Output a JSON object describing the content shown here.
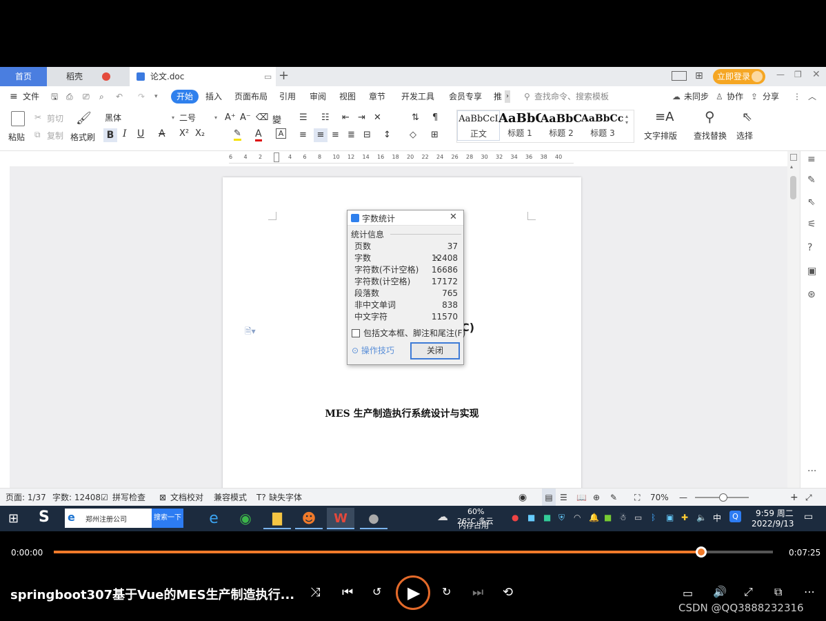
{
  "tabs": {
    "home": "首页",
    "daoke": "稻壳",
    "doc": "论文.doc",
    "login": "立即登录"
  },
  "menu": {
    "file": "文件",
    "items": [
      "开始",
      "插入",
      "页面布局",
      "引用",
      "审阅",
      "视图",
      "章节",
      "开发工具",
      "会员专享",
      "推"
    ],
    "search_placeholder": "查找命令、搜索模板",
    "sync": "未同步",
    "collab": "协作",
    "share": "分享"
  },
  "ribbon": {
    "paste": "粘贴",
    "cut": "剪切",
    "copy": "复制",
    "format_painter": "格式刷",
    "font": "黑体",
    "size": "二号",
    "styles": [
      {
        "preview": "AaBbCcI",
        "label": "正文"
      },
      {
        "preview": "AaBbC",
        "label": "标题 1"
      },
      {
        "preview": "AaBbC",
        "label": "标题 2"
      },
      {
        "preview": "AaBbCcI",
        "label": "标题 3"
      }
    ],
    "text_layout": "文字排版",
    "find_replace": "查找替换",
    "select": "选择"
  },
  "ruler_ticks": [
    "6",
    "4",
    "2",
    "2",
    "4",
    "6",
    "8",
    "10",
    "12",
    "14",
    "16",
    "18",
    "20",
    "22",
    "24",
    "26",
    "28",
    "30",
    "32",
    "34",
    "36",
    "38",
    "40"
  ],
  "document": {
    "title": "MES 生产制造执行系统设计与实现",
    "partial_glyph": "C)"
  },
  "dialog": {
    "title": "字数统计",
    "section": "统计信息",
    "rows": [
      {
        "label": "页数",
        "value": "37"
      },
      {
        "label": "字数",
        "value": "12408"
      },
      {
        "label": "字符数(不计空格)",
        "value": "16686"
      },
      {
        "label": "字符数(计空格)",
        "value": "17172"
      },
      {
        "label": "段落数",
        "value": "765"
      },
      {
        "label": "非中文单词",
        "value": "838"
      },
      {
        "label": "中文字符",
        "value": "11570"
      }
    ],
    "checkbox": "包括文本框、脚注和尾注(F)",
    "tips": "操作技巧",
    "close": "关闭"
  },
  "status": {
    "page": "页面: 1/37",
    "words": "字数: 12408",
    "spell": "拼写检查",
    "proof": "文档校对",
    "compat": "兼容模式",
    "missing_font": "缺失字体",
    "zoom": "70%"
  },
  "taskbar": {
    "search_text": "郑州注册公司",
    "search_btn": "搜索一下",
    "weather": "26°C 多云",
    "memory": "60%",
    "memory_label": "内存占用",
    "ime": "中",
    "time": "9:59 周二",
    "date": "2022/9/13"
  },
  "player": {
    "current": "0:00:00",
    "total": "0:07:25",
    "progress": 0.9,
    "title": "springboot307基于Vue的MES生产制造执行...",
    "watermark": "CSDN @QQ3888232316"
  },
  "colors": {
    "accent": "#2f80ed",
    "progress": "#f07a2a",
    "taskbar": "#1c2b3e",
    "login": "#f5a623"
  }
}
